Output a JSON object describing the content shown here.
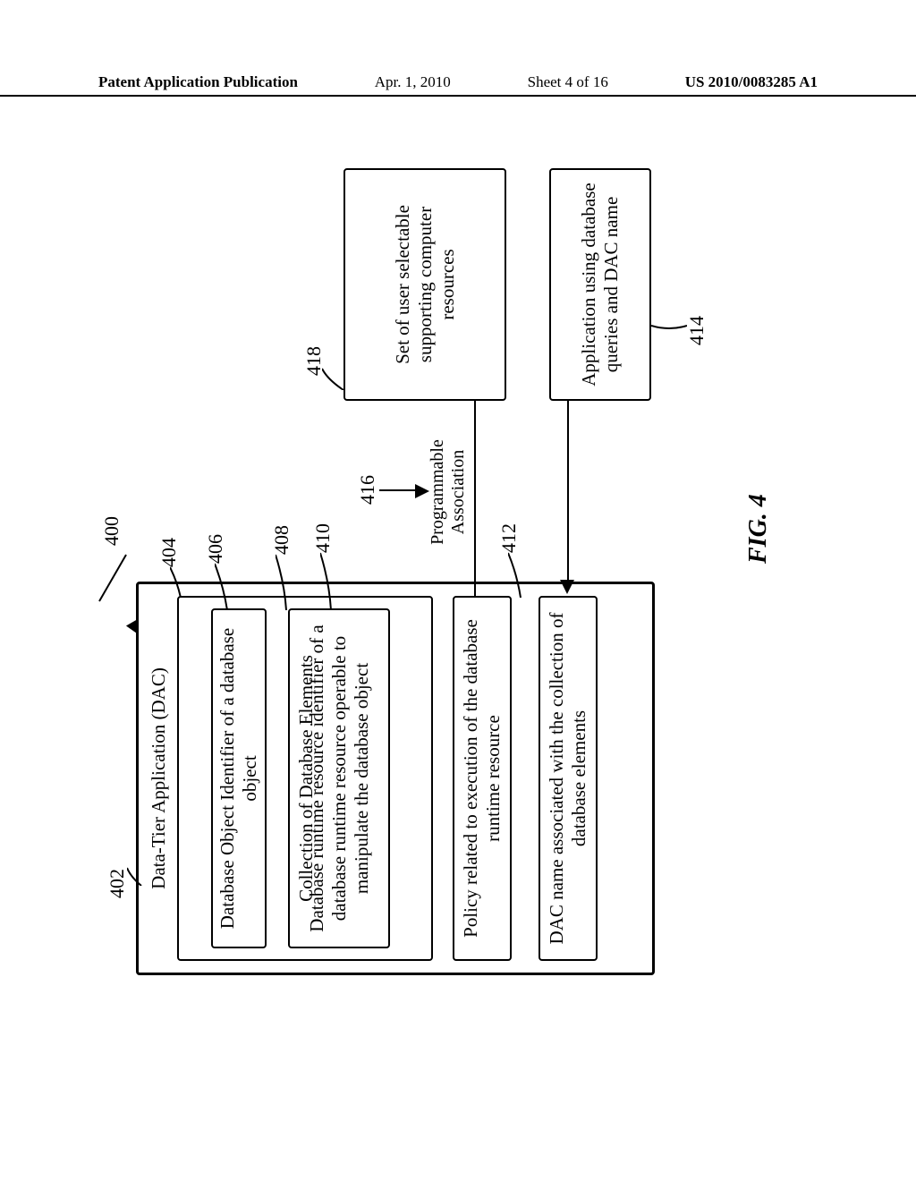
{
  "header": {
    "left": "Patent Application Publication",
    "date": "Apr. 1, 2010",
    "sheet": "Sheet 4 of 16",
    "pub": "US 2010/0083285 A1"
  },
  "refs": {
    "r400": "400",
    "r402": "402",
    "r404": "404",
    "r406": "406",
    "r408": "408",
    "r410": "410",
    "r412": "412",
    "r414": "414",
    "r416": "416",
    "r418": "418"
  },
  "boxes": {
    "dac_title": "Data-Tier Application (DAC)",
    "collection": "Collection of Database Elements",
    "obj_id": "Database Object Identifier of a database object",
    "runtime": "Database runtime resource identifier of a database runtime resource operable to manipulate the database object",
    "policy": "Policy related to execution of the database runtime resource",
    "dac_name": "DAC name associated with the collection of database elements",
    "supporting": "Set of user selectable supporting computer resources",
    "app": "Application using database queries and DAC name"
  },
  "labels": {
    "assoc_l1": "Programmable",
    "assoc_l2": "Association"
  },
  "caption": "FIG. 4"
}
